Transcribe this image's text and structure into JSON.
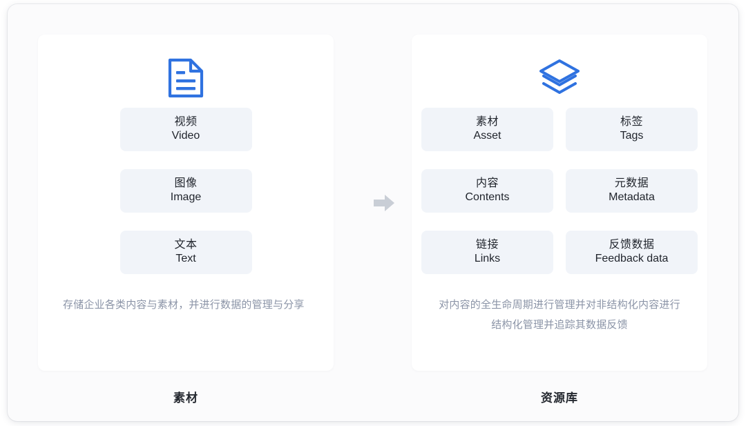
{
  "diagram": {
    "connector": {
      "icon": "arrow-right-icon",
      "color": "#c9cdd4"
    },
    "accent_color": "#2f72e0",
    "chip_bg": "#f1f4f9",
    "columns": [
      {
        "id": "asset",
        "icon": "document-icon",
        "layout": "stack",
        "items": [
          {
            "zh": "视频",
            "en": "Video"
          },
          {
            "zh": "图像",
            "en": "Image"
          },
          {
            "zh": "文本",
            "en": "Text"
          }
        ],
        "description": "存储企业各类内容与素材，并进行数据的管理与分享",
        "label": "素材"
      },
      {
        "id": "resource-library",
        "icon": "layers-icon",
        "layout": "grid",
        "items": [
          {
            "zh": "素材",
            "en": "Asset"
          },
          {
            "zh": "标签",
            "en": "Tags"
          },
          {
            "zh": "内容",
            "en": "Contents"
          },
          {
            "zh": "元数据",
            "en": "Metadata"
          },
          {
            "zh": "链接",
            "en": "Links"
          },
          {
            "zh": "反馈数据",
            "en": "Feedback data"
          }
        ],
        "description": "对内容的全生命周期进行管理并对非结构化内容进行结构化管理并追踪其数据反馈",
        "label": "资源库"
      }
    ]
  }
}
